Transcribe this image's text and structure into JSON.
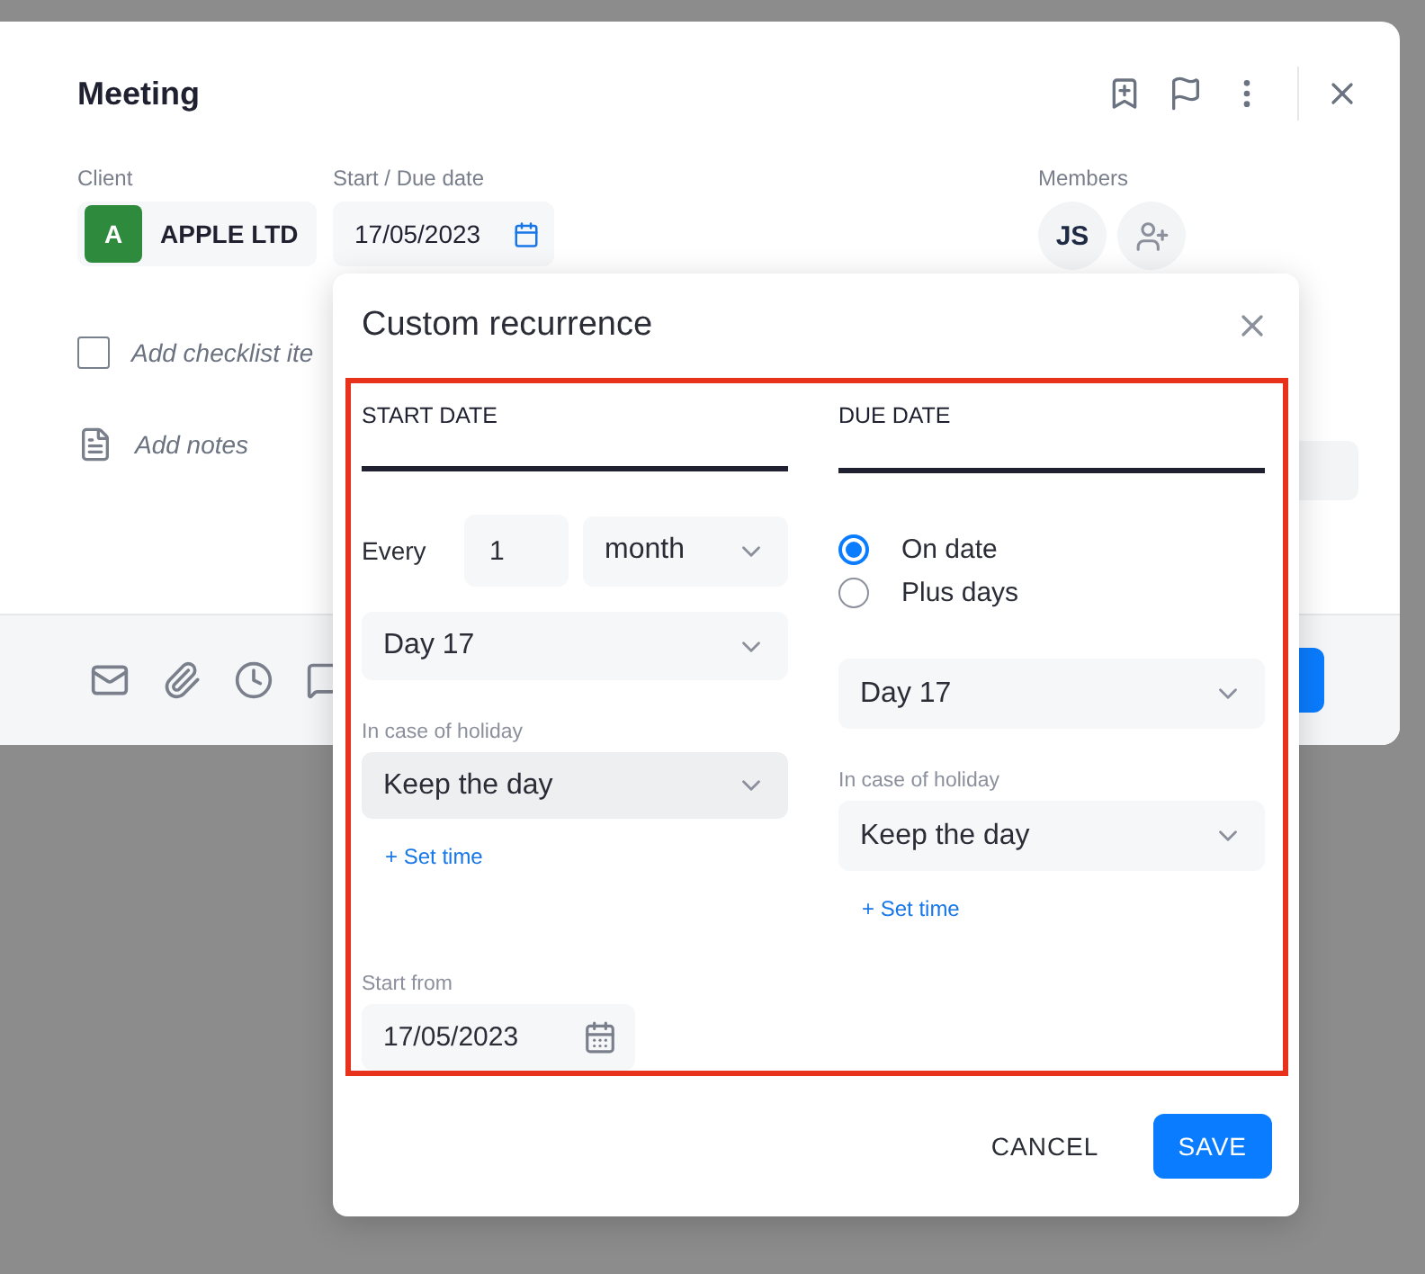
{
  "dialog": {
    "title": "Meeting",
    "client": {
      "label": "Client",
      "initial": "A",
      "name": "APPLE LTD"
    },
    "date": {
      "label": "Start / Due date",
      "value": "17/05/2023"
    },
    "members": {
      "label": "Members",
      "avatars": [
        "JS"
      ]
    },
    "checklist": {
      "hint": "Add checklist ite",
      "checked": false
    },
    "notes": {
      "hint": "Add notes"
    }
  },
  "recurrence": {
    "title": "Custom recurrence",
    "start": {
      "heading": "START DATE",
      "every_label": "Every",
      "interval": "1",
      "unit": "month",
      "day": "Day 17",
      "holiday_label": "In case of holiday",
      "holiday": "Keep the day",
      "set_time": "+ Set time",
      "start_from_label": "Start from",
      "start_from": "17/05/2023"
    },
    "due": {
      "heading": "DUE DATE",
      "options": [
        {
          "label": "On date",
          "selected": true
        },
        {
          "label": "Plus days",
          "selected": false
        }
      ],
      "day": "Day 17",
      "holiday_label": "In case of holiday",
      "holiday": "Keep the day",
      "set_time": "+ Set time"
    },
    "buttons": [
      {
        "label": "CANCEL",
        "kind": "text"
      },
      {
        "label": "SAVE",
        "kind": "primary"
      }
    ]
  }
}
